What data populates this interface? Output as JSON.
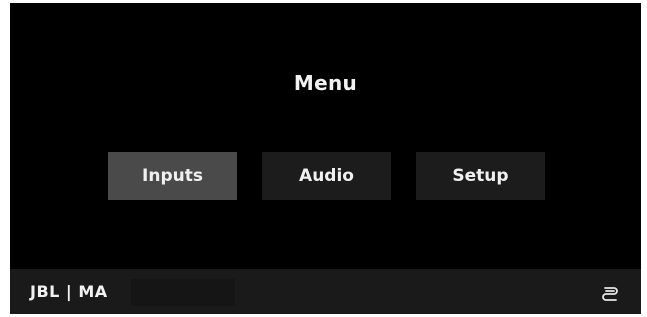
{
  "menu": {
    "title": "Menu",
    "buttons": [
      {
        "label": "Inputs",
        "selected": true
      },
      {
        "label": "Audio",
        "selected": false
      },
      {
        "label": "Setup",
        "selected": false
      }
    ]
  },
  "footer": {
    "brand": "JBL | MA",
    "status_icon": "connection-icon"
  },
  "colors": {
    "background": "#000000",
    "button_default": "#1c1c1c",
    "button_selected": "#4a4a4a",
    "footer": "#1a1a1a",
    "text": "#f2f2f2"
  }
}
